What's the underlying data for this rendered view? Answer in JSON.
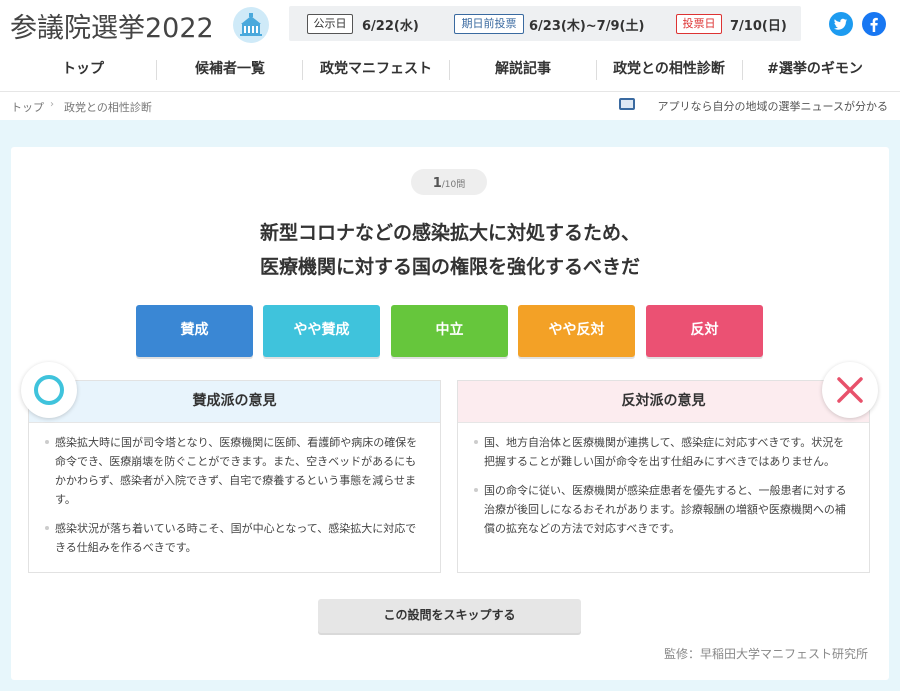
{
  "header": {
    "site_title": "参議院選挙2022",
    "dates": [
      {
        "label": "公示日",
        "value": "6/22(水)"
      },
      {
        "label": "期日前投票",
        "value": "6/23(木)~7/9(土)"
      },
      {
        "label": "投票日",
        "value": "7/10(日)"
      }
    ],
    "social": [
      "twitter-icon",
      "facebook-icon"
    ]
  },
  "nav": [
    {
      "label": "トップ"
    },
    {
      "label": "候補者一覧"
    },
    {
      "label": "政党マニフェスト"
    },
    {
      "label": "解説記事"
    },
    {
      "label": "政党との相性診断"
    },
    {
      "label": "#選挙のギモン"
    }
  ],
  "breadcrumb": {
    "items": [
      "トップ",
      "政党との相性診断"
    ],
    "app_note": "アプリなら自分の地域の選挙ニュースが分かる"
  },
  "quiz": {
    "current": "1",
    "total": "/10問",
    "question_line1": "新型コロナなどの感染拡大に対処するため、",
    "question_line2": "医療機関に対する国の権限を強化するべきだ",
    "choices": [
      {
        "label": "賛成",
        "color": "#3a87d4"
      },
      {
        "label": "やや賛成",
        "color": "#3fc3dc"
      },
      {
        "label": "中立",
        "color": "#66c63c"
      },
      {
        "label": "やや反対",
        "color": "#f3a126"
      },
      {
        "label": "反対",
        "color": "#eb5173"
      }
    ],
    "pro": {
      "title": "賛成派の意見",
      "points": [
        "感染拡大時に国が司令塔となり、医療機関に医師、看護師や病床の確保を命令でき、医療崩壊を防ぐことができます。また、空きベッドがあるにもかかわらず、感染者が入院できず、自宅で療養するという事態を減らせます。",
        "感染状況が落ち着いている時こそ、国が中心となって、感染拡大に対応できる仕組みを作るべきです。"
      ],
      "mark_color": "#3fc3dc"
    },
    "con": {
      "title": "反対派の意見",
      "points": [
        "国、地方自治体と医療機関が連携して、感染症に対応すべきです。状況を把握することが難しい国が命令を出す仕組みにすべきではありません。",
        "国の命令に従い、医療機関が感染症患者を優先すると、一般患者に対する治療が後回しになるおそれがあります。診療報酬の増額や医療機関への補償の拡充などの方法で対応すべきです。"
      ],
      "mark_color": "#e8516b"
    },
    "skip_label": "この設問をスキップする",
    "supervisor": "監修：早稲田大学マニフェスト研究所"
  }
}
